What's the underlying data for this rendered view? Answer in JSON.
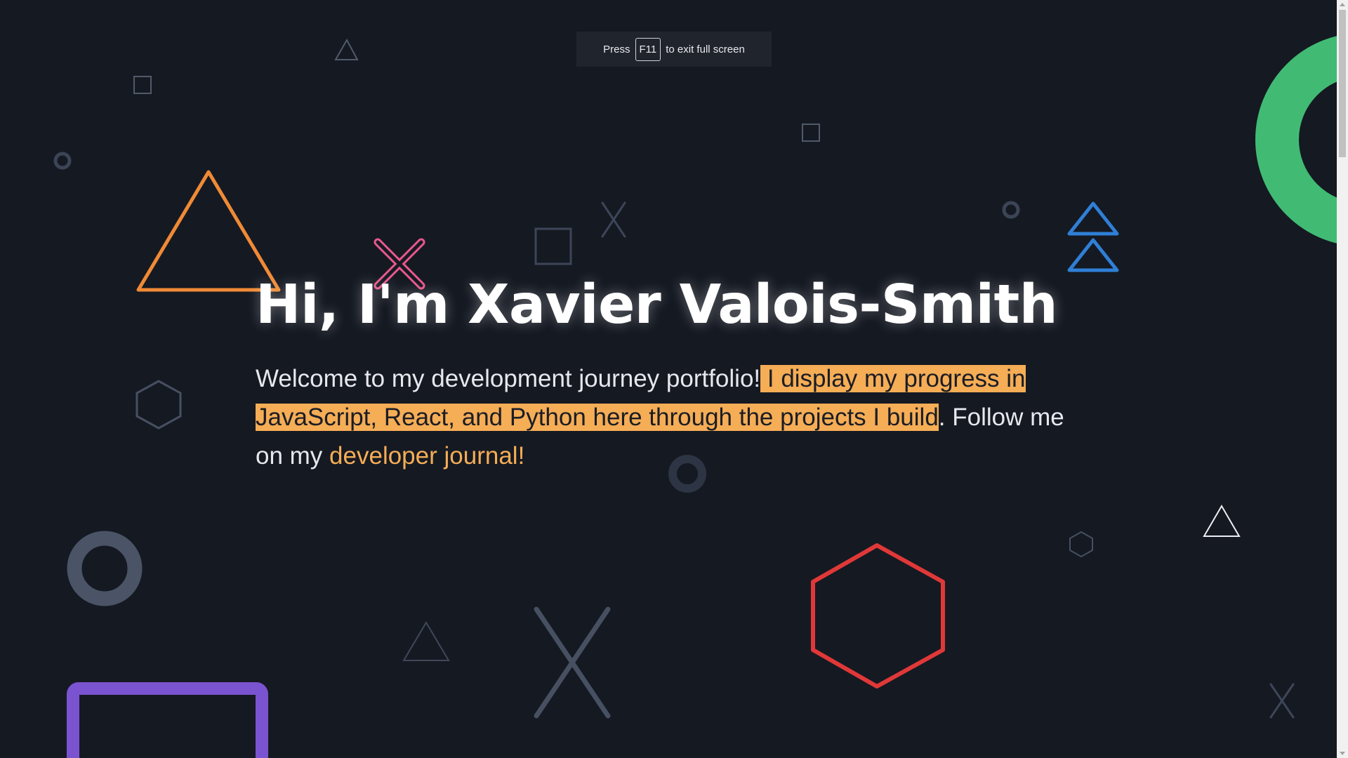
{
  "fullscreen_notice": {
    "prefix": "Press",
    "key": "F11",
    "suffix": "to exit full screen"
  },
  "hero": {
    "title": "Hi, I'm Xavier Valois-Smith",
    "intro_plain": "Welcome to my development journey portfolio!",
    "intro_highlight_1": " I display my progress in",
    "intro_highlight_2": "JavaScript, React, and Python here through the projects I build",
    "intro_after": ". Follow me on my ",
    "journal_link": "developer journal!"
  },
  "colors": {
    "background": "#151922",
    "highlight": "#f5ad56",
    "shape_orange": "#f08a35",
    "shape_pink": "#e8578d",
    "shape_blue": "#2f7fd6",
    "shape_green": "#41bb74",
    "shape_red": "#e03838",
    "shape_purple": "#7a54d0",
    "shape_gray": "#465061"
  },
  "decorative_shapes": [
    "triangle-icon",
    "square-icon",
    "circle-icon",
    "x-icon",
    "hexagon-icon",
    "double-triangle-icon"
  ]
}
